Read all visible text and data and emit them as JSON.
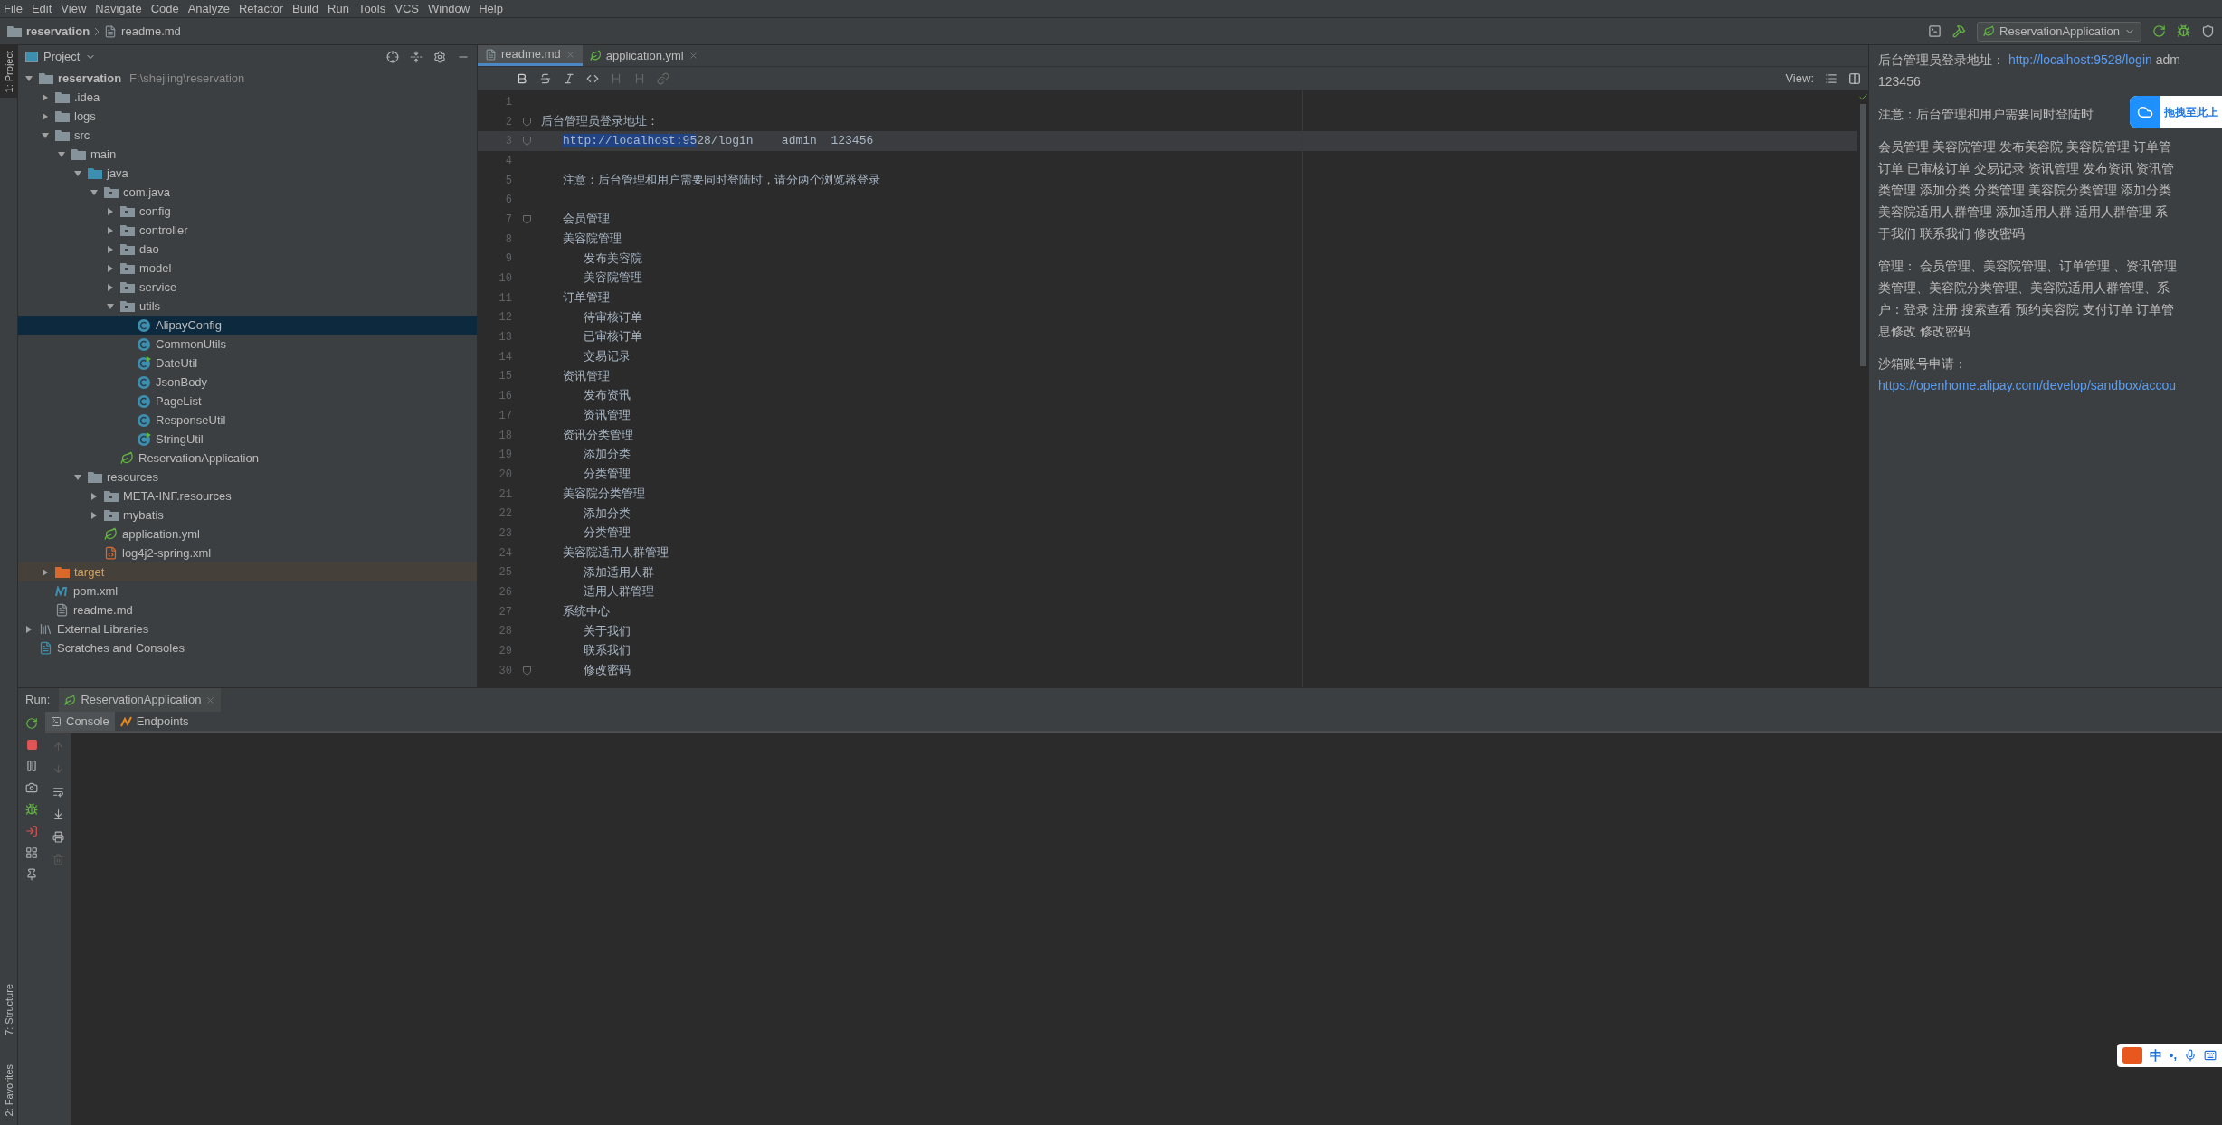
{
  "menu": [
    "File",
    "Edit",
    "View",
    "Navigate",
    "Code",
    "Analyze",
    "Refactor",
    "Build",
    "Run",
    "Tools",
    "VCS",
    "Window",
    "Help"
  ],
  "breadcrumb": [
    "reservation",
    "readme.md"
  ],
  "run_config": "ReservationApplication",
  "side_stripe": {
    "top": [
      {
        "label": "1: Project",
        "selected": true
      }
    ],
    "bottom": [
      {
        "label": "7: Structure",
        "selected": false
      },
      {
        "label": "2: Favorites",
        "selected": false
      }
    ]
  },
  "project_panel": {
    "title": "Project",
    "tree": [
      {
        "label": "reservation",
        "path": "F:\\shejiing\\reservation",
        "kind": "module",
        "expanded": true,
        "selected": false,
        "children": [
          {
            "label": ".idea",
            "kind": "folder",
            "expanded": false,
            "selected": false
          },
          {
            "label": "logs",
            "kind": "folder",
            "expanded": false,
            "selected": false
          },
          {
            "label": "src",
            "kind": "folder",
            "expanded": true,
            "selected": false,
            "children": [
              {
                "label": "main",
                "kind": "folder",
                "expanded": true,
                "selected": false,
                "children": [
                  {
                    "label": "java",
                    "kind": "source-folder",
                    "expanded": true,
                    "selected": false,
                    "children": [
                      {
                        "label": "com.java",
                        "kind": "package",
                        "expanded": true,
                        "selected": false,
                        "children": [
                          {
                            "label": "config",
                            "kind": "package",
                            "expanded": false,
                            "selected": false
                          },
                          {
                            "label": "controller",
                            "kind": "package",
                            "expanded": false,
                            "selected": false
                          },
                          {
                            "label": "dao",
                            "kind": "package",
                            "expanded": false,
                            "selected": false
                          },
                          {
                            "label": "model",
                            "kind": "package",
                            "expanded": false,
                            "selected": false
                          },
                          {
                            "label": "service",
                            "kind": "package",
                            "expanded": false,
                            "selected": false
                          },
                          {
                            "label": "utils",
                            "kind": "package",
                            "expanded": true,
                            "selected": false,
                            "children": [
                              {
                                "label": "AlipayConfig",
                                "kind": "class",
                                "selected": true
                              },
                              {
                                "label": "CommonUtils",
                                "kind": "class",
                                "selected": false
                              },
                              {
                                "label": "DateUtil",
                                "kind": "class-badge",
                                "selected": false
                              },
                              {
                                "label": "JsonBody",
                                "kind": "class",
                                "selected": false
                              },
                              {
                                "label": "PageList",
                                "kind": "class",
                                "selected": false
                              },
                              {
                                "label": "ResponseUtil",
                                "kind": "class",
                                "selected": false
                              },
                              {
                                "label": "StringUtil",
                                "kind": "class-badge",
                                "selected": false
                              }
                            ]
                          },
                          {
                            "label": "ReservationApplication",
                            "kind": "spring-class",
                            "selected": false
                          }
                        ]
                      }
                    ]
                  },
                  {
                    "label": "resources",
                    "kind": "resource-folder",
                    "expanded": true,
                    "selected": false,
                    "children": [
                      {
                        "label": "META-INF.resources",
                        "kind": "package",
                        "expanded": false,
                        "selected": false
                      },
                      {
                        "label": "mybatis",
                        "kind": "package",
                        "expanded": false,
                        "selected": false
                      },
                      {
                        "label": "application.yml",
                        "kind": "yml",
                        "selected": false
                      },
                      {
                        "label": "log4j2-spring.xml",
                        "kind": "xml",
                        "selected": false
                      }
                    ]
                  }
                ]
              }
            ]
          },
          {
            "label": "target",
            "kind": "excluded-folder",
            "expanded": false,
            "selected": false
          },
          {
            "label": "pom.xml",
            "kind": "maven",
            "selected": false
          },
          {
            "label": "readme.md",
            "kind": "markdown",
            "selected": false
          }
        ]
      },
      {
        "label": "External Libraries",
        "kind": "libraries",
        "expanded": false,
        "selected": false
      },
      {
        "label": "Scratches and Consoles",
        "kind": "scratches",
        "selected": false
      }
    ]
  },
  "editor": {
    "tabs": [
      {
        "label": "readme.md",
        "kind": "markdown",
        "selected": true
      },
      {
        "label": "application.yml",
        "kind": "yml",
        "selected": false
      }
    ],
    "view_label": "View:",
    "lines": [
      {
        "number": "1",
        "fold": false,
        "current": false
      },
      {
        "number": "2",
        "kind": "heading",
        "fold": true,
        "current": false,
        "parts": [
          {
            "text": "后台管理员登录地址：",
            "selected": false
          }
        ]
      },
      {
        "number": "3",
        "kind": "item",
        "fold": true,
        "current": true,
        "parts": [
          {
            "text": "http://localhost:95",
            "selected": true
          },
          {
            "text": "28/login    admin  123456",
            "selected": false
          }
        ]
      },
      {
        "number": "4",
        "fold": false,
        "current": false
      },
      {
        "number": "5",
        "kind": "item",
        "fold": false,
        "current": false,
        "parts": [
          {
            "text": "注意：后台管理和用户需要同时登陆时，请分两个浏览器登录",
            "selected": false
          }
        ]
      },
      {
        "number": "6",
        "fold": false,
        "current": false
      },
      {
        "number": "7",
        "kind": "item",
        "fold": true,
        "current": false,
        "parts": [
          {
            "text": "会员管理",
            "selected": false
          }
        ]
      },
      {
        "number": "8",
        "kind": "item",
        "fold": false,
        "current": false,
        "parts": [
          {
            "text": "美容院管理",
            "selected": false
          }
        ]
      },
      {
        "number": "9",
        "kind": "subitem",
        "fold": false,
        "current": false,
        "parts": [
          {
            "text": "发布美容院",
            "selected": false
          }
        ]
      },
      {
        "number": "10",
        "kind": "subitem",
        "fold": false,
        "current": false,
        "parts": [
          {
            "text": "美容院管理",
            "selected": false
          }
        ]
      },
      {
        "number": "11",
        "kind": "item",
        "fold": false,
        "current": false,
        "parts": [
          {
            "text": "订单管理",
            "selected": false
          }
        ]
      },
      {
        "number": "12",
        "kind": "subitem",
        "fold": false,
        "current": false,
        "parts": [
          {
            "text": "待审核订单",
            "selected": false
          }
        ]
      },
      {
        "number": "13",
        "kind": "subitem",
        "fold": false,
        "current": false,
        "parts": [
          {
            "text": "已审核订单",
            "selected": false
          }
        ]
      },
      {
        "number": "14",
        "kind": "subitem",
        "fold": false,
        "current": false,
        "parts": [
          {
            "text": "交易记录",
            "selected": false
          }
        ]
      },
      {
        "number": "15",
        "kind": "item",
        "fold": false,
        "current": false,
        "parts": [
          {
            "text": "资讯管理",
            "selected": false
          }
        ]
      },
      {
        "number": "16",
        "kind": "subitem",
        "fold": false,
        "current": false,
        "parts": [
          {
            "text": "发布资讯",
            "selected": false
          }
        ]
      },
      {
        "number": "17",
        "kind": "subitem",
        "fold": false,
        "current": false,
        "parts": [
          {
            "text": "资讯管理",
            "selected": false
          }
        ]
      },
      {
        "number": "18",
        "kind": "item",
        "fold": false,
        "current": false,
        "parts": [
          {
            "text": "资讯分类管理",
            "selected": false
          }
        ]
      },
      {
        "number": "19",
        "kind": "subitem",
        "fold": false,
        "current": false,
        "parts": [
          {
            "text": "添加分类",
            "selected": false
          }
        ]
      },
      {
        "number": "20",
        "kind": "subitem",
        "fold": false,
        "current": false,
        "parts": [
          {
            "text": "分类管理",
            "selected": false
          }
        ]
      },
      {
        "number": "21",
        "kind": "item",
        "fold": false,
        "current": false,
        "parts": [
          {
            "text": "美容院分类管理",
            "selected": false
          }
        ]
      },
      {
        "number": "22",
        "kind": "subitem",
        "fold": false,
        "current": false,
        "parts": [
          {
            "text": "添加分类",
            "selected": false
          }
        ]
      },
      {
        "number": "23",
        "kind": "subitem",
        "fold": false,
        "current": false,
        "parts": [
          {
            "text": "分类管理",
            "selected": false
          }
        ]
      },
      {
        "number": "24",
        "kind": "item",
        "fold": false,
        "current": false,
        "parts": [
          {
            "text": "美容院适用人群管理",
            "selected": false
          }
        ]
      },
      {
        "number": "25",
        "kind": "subitem",
        "fold": false,
        "current": false,
        "parts": [
          {
            "text": "添加适用人群",
            "selected": false
          }
        ]
      },
      {
        "number": "26",
        "kind": "subitem",
        "fold": false,
        "current": false,
        "parts": [
          {
            "text": "适用人群管理",
            "selected": false
          }
        ]
      },
      {
        "number": "27",
        "kind": "item",
        "fold": false,
        "current": false,
        "parts": [
          {
            "text": "系统中心",
            "selected": false
          }
        ]
      },
      {
        "number": "28",
        "kind": "subitem",
        "fold": false,
        "current": false,
        "parts": [
          {
            "text": "关于我们",
            "selected": false
          }
        ]
      },
      {
        "number": "29",
        "kind": "subitem",
        "fold": false,
        "current": false,
        "parts": [
          {
            "text": "联系我们",
            "selected": false
          }
        ]
      },
      {
        "number": "30",
        "kind": "subitem",
        "fold": true,
        "current": false,
        "parts": [
          {
            "text": "修改密码",
            "selected": false
          }
        ]
      }
    ]
  },
  "preview": {
    "paragraphs": [
      {
        "lines": [
          [
            {
              "kind": "text",
              "text": "后台管理员登录地址："
            },
            {
              "kind": "link",
              "text": "http://localhost:9528/login"
            },
            {
              "kind": "text",
              "text": "adm"
            }
          ],
          [
            {
              "kind": "text",
              "text": "123456"
            }
          ]
        ]
      },
      {
        "lines": [
          [
            {
              "kind": "text",
              "text": "注意：后台管理和用户需要同时登陆时"
            }
          ]
        ]
      },
      {
        "lines": [
          [
            {
              "kind": "text",
              "text": "会员管理 美容院管理 发布美容院 美容院管理 订单管"
            }
          ],
          [
            {
              "kind": "text",
              "text": "订单 已审核订单 交易记录 资讯管理 发布资讯 资讯管"
            }
          ],
          [
            {
              "kind": "text",
              "text": "类管理 添加分类 分类管理 美容院分类管理 添加分类"
            }
          ],
          [
            {
              "kind": "text",
              "text": "美容院适用人群管理 添加适用人群 适用人群管理 系"
            }
          ],
          [
            {
              "kind": "text",
              "text": "于我们 联系我们 修改密码"
            }
          ]
        ]
      },
      {
        "lines": [
          [
            {
              "kind": "text",
              "text": "管理： 会员管理、美容院管理、订单管理 、资讯管理"
            }
          ],
          [
            {
              "kind": "text",
              "text": "类管理、美容院分类管理、美容院适用人群管理、系"
            }
          ],
          [
            {
              "kind": "text",
              "text": "户：登录 注册 搜索查看 预约美容院 支付订单 订单管"
            }
          ],
          [
            {
              "kind": "text",
              "text": "息修改 修改密码"
            }
          ]
        ]
      },
      {
        "lines": [
          [
            {
              "kind": "text",
              "text": "沙箱账号申请："
            }
          ],
          [
            {
              "kind": "link",
              "text": "https://openhome.alipay.com/develop/sandbox/accou"
            }
          ]
        ]
      }
    ]
  },
  "upload_widget": {
    "text": "拖拽至此上"
  },
  "run": {
    "label": "Run:",
    "tab": "ReservationApplication",
    "subtabs": [
      {
        "label": "Console",
        "kind": "console",
        "selected": true
      },
      {
        "label": "Endpoints",
        "kind": "endpoints",
        "selected": false
      }
    ]
  },
  "ime": {
    "mode": "中",
    "punct": "•,"
  }
}
